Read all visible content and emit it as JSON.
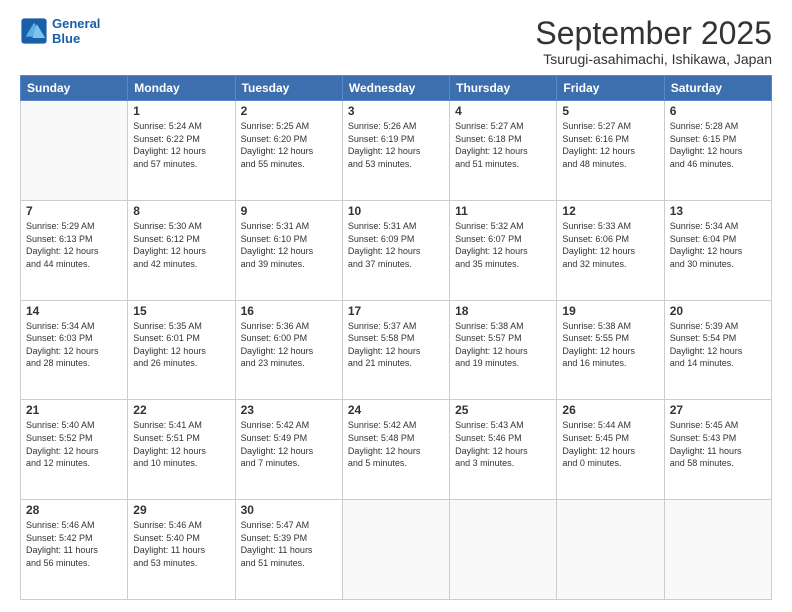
{
  "logo": {
    "line1": "General",
    "line2": "Blue"
  },
  "title": "September 2025",
  "subtitle": "Tsurugi-asahimachi, Ishikawa, Japan",
  "days_of_week": [
    "Sunday",
    "Monday",
    "Tuesday",
    "Wednesday",
    "Thursday",
    "Friday",
    "Saturday"
  ],
  "weeks": [
    [
      {
        "day": "",
        "detail": ""
      },
      {
        "day": "1",
        "detail": "Sunrise: 5:24 AM\nSunset: 6:22 PM\nDaylight: 12 hours\nand 57 minutes."
      },
      {
        "day": "2",
        "detail": "Sunrise: 5:25 AM\nSunset: 6:20 PM\nDaylight: 12 hours\nand 55 minutes."
      },
      {
        "day": "3",
        "detail": "Sunrise: 5:26 AM\nSunset: 6:19 PM\nDaylight: 12 hours\nand 53 minutes."
      },
      {
        "day": "4",
        "detail": "Sunrise: 5:27 AM\nSunset: 6:18 PM\nDaylight: 12 hours\nand 51 minutes."
      },
      {
        "day": "5",
        "detail": "Sunrise: 5:27 AM\nSunset: 6:16 PM\nDaylight: 12 hours\nand 48 minutes."
      },
      {
        "day": "6",
        "detail": "Sunrise: 5:28 AM\nSunset: 6:15 PM\nDaylight: 12 hours\nand 46 minutes."
      }
    ],
    [
      {
        "day": "7",
        "detail": "Sunrise: 5:29 AM\nSunset: 6:13 PM\nDaylight: 12 hours\nand 44 minutes."
      },
      {
        "day": "8",
        "detail": "Sunrise: 5:30 AM\nSunset: 6:12 PM\nDaylight: 12 hours\nand 42 minutes."
      },
      {
        "day": "9",
        "detail": "Sunrise: 5:31 AM\nSunset: 6:10 PM\nDaylight: 12 hours\nand 39 minutes."
      },
      {
        "day": "10",
        "detail": "Sunrise: 5:31 AM\nSunset: 6:09 PM\nDaylight: 12 hours\nand 37 minutes."
      },
      {
        "day": "11",
        "detail": "Sunrise: 5:32 AM\nSunset: 6:07 PM\nDaylight: 12 hours\nand 35 minutes."
      },
      {
        "day": "12",
        "detail": "Sunrise: 5:33 AM\nSunset: 6:06 PM\nDaylight: 12 hours\nand 32 minutes."
      },
      {
        "day": "13",
        "detail": "Sunrise: 5:34 AM\nSunset: 6:04 PM\nDaylight: 12 hours\nand 30 minutes."
      }
    ],
    [
      {
        "day": "14",
        "detail": "Sunrise: 5:34 AM\nSunset: 6:03 PM\nDaylight: 12 hours\nand 28 minutes."
      },
      {
        "day": "15",
        "detail": "Sunrise: 5:35 AM\nSunset: 6:01 PM\nDaylight: 12 hours\nand 26 minutes."
      },
      {
        "day": "16",
        "detail": "Sunrise: 5:36 AM\nSunset: 6:00 PM\nDaylight: 12 hours\nand 23 minutes."
      },
      {
        "day": "17",
        "detail": "Sunrise: 5:37 AM\nSunset: 5:58 PM\nDaylight: 12 hours\nand 21 minutes."
      },
      {
        "day": "18",
        "detail": "Sunrise: 5:38 AM\nSunset: 5:57 PM\nDaylight: 12 hours\nand 19 minutes."
      },
      {
        "day": "19",
        "detail": "Sunrise: 5:38 AM\nSunset: 5:55 PM\nDaylight: 12 hours\nand 16 minutes."
      },
      {
        "day": "20",
        "detail": "Sunrise: 5:39 AM\nSunset: 5:54 PM\nDaylight: 12 hours\nand 14 minutes."
      }
    ],
    [
      {
        "day": "21",
        "detail": "Sunrise: 5:40 AM\nSunset: 5:52 PM\nDaylight: 12 hours\nand 12 minutes."
      },
      {
        "day": "22",
        "detail": "Sunrise: 5:41 AM\nSunset: 5:51 PM\nDaylight: 12 hours\nand 10 minutes."
      },
      {
        "day": "23",
        "detail": "Sunrise: 5:42 AM\nSunset: 5:49 PM\nDaylight: 12 hours\nand 7 minutes."
      },
      {
        "day": "24",
        "detail": "Sunrise: 5:42 AM\nSunset: 5:48 PM\nDaylight: 12 hours\nand 5 minutes."
      },
      {
        "day": "25",
        "detail": "Sunrise: 5:43 AM\nSunset: 5:46 PM\nDaylight: 12 hours\nand 3 minutes."
      },
      {
        "day": "26",
        "detail": "Sunrise: 5:44 AM\nSunset: 5:45 PM\nDaylight: 12 hours\nand 0 minutes."
      },
      {
        "day": "27",
        "detail": "Sunrise: 5:45 AM\nSunset: 5:43 PM\nDaylight: 11 hours\nand 58 minutes."
      }
    ],
    [
      {
        "day": "28",
        "detail": "Sunrise: 5:46 AM\nSunset: 5:42 PM\nDaylight: 11 hours\nand 56 minutes."
      },
      {
        "day": "29",
        "detail": "Sunrise: 5:46 AM\nSunset: 5:40 PM\nDaylight: 11 hours\nand 53 minutes."
      },
      {
        "day": "30",
        "detail": "Sunrise: 5:47 AM\nSunset: 5:39 PM\nDaylight: 11 hours\nand 51 minutes."
      },
      {
        "day": "",
        "detail": ""
      },
      {
        "day": "",
        "detail": ""
      },
      {
        "day": "",
        "detail": ""
      },
      {
        "day": "",
        "detail": ""
      }
    ]
  ]
}
